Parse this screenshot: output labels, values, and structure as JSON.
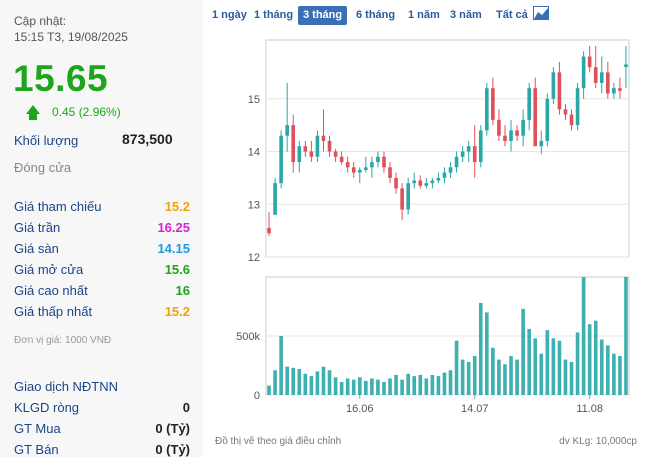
{
  "update": {
    "label": "Cập nhật:",
    "time": "15:15 T3, 19/08/2025"
  },
  "price": "15.65",
  "change": "0.45 (2.96%)",
  "volume": {
    "label": "Khối lượng",
    "value": "873,500"
  },
  "close_label": "Đóng cửa",
  "stats": [
    {
      "label": "Giá tham chiếu",
      "value": "15.2",
      "color": "#f0a30a"
    },
    {
      "label": "Giá trần",
      "value": "16.25",
      "color": "#d426d4"
    },
    {
      "label": "Giá sàn",
      "value": "14.15",
      "color": "#1c9be0"
    },
    {
      "label": "Giá mở cửa",
      "value": "15.6",
      "color": "#1ea51e"
    },
    {
      "label": "Giá cao nhất",
      "value": "16",
      "color": "#1ea51e"
    },
    {
      "label": "Giá thấp nhất",
      "value": "15.2",
      "color": "#f0a30a"
    }
  ],
  "unit_note": "Đơn vị giá: 1000 VNĐ",
  "foreign": {
    "title": "Giao dịch NĐTNN",
    "rows": [
      {
        "label": "KLGD ròng",
        "value": "0"
      },
      {
        "label": "GT Mua",
        "value": "0 (Tỷ)"
      },
      {
        "label": "GT Bán",
        "value": "0 (Tỷ)"
      }
    ]
  },
  "tabs": [
    "1 ngày",
    "1 tháng",
    "3 tháng",
    "6 tháng",
    "1 năm",
    "3 năm",
    "Tất cả"
  ],
  "active_tab": "3 tháng",
  "chart_note": "Đồ thị vẽ theo giá điều chỉnh",
  "volume_note": "dv KLg: 10,000cp",
  "chart_data": {
    "type": "candlestick",
    "price_axis": {
      "ylim": [
        12,
        16
      ],
      "ticks": [
        "12",
        "13",
        "14",
        "15"
      ]
    },
    "volume_axis": {
      "ylim": [
        0,
        1000
      ],
      "ticks": [
        "0",
        "500k"
      ]
    },
    "x_ticks": [
      {
        "label": "16.06",
        "index": 15
      },
      {
        "label": "14.07",
        "index": 34
      },
      {
        "label": "11.08",
        "index": 53
      }
    ],
    "up_color": "#2aa7a7",
    "down_color": "#e0505a",
    "candles": [
      [
        12.55,
        12.85,
        12.4,
        12.45,
        80
      ],
      [
        12.8,
        13.5,
        12.8,
        13.4,
        210
      ],
      [
        13.4,
        14.4,
        13.3,
        14.3,
        500
      ],
      [
        14.3,
        15.3,
        14.0,
        14.5,
        240
      ],
      [
        14.5,
        14.7,
        13.6,
        13.8,
        230
      ],
      [
        13.8,
        14.2,
        13.6,
        14.1,
        220
      ],
      [
        14.1,
        14.2,
        13.9,
        14.0,
        180
      ],
      [
        14.0,
        14.2,
        13.8,
        13.9,
        160
      ],
      [
        13.9,
        14.4,
        13.8,
        14.3,
        200
      ],
      [
        14.3,
        14.8,
        14.0,
        14.2,
        240
      ],
      [
        14.2,
        14.3,
        13.9,
        14.0,
        210
      ],
      [
        14.0,
        14.05,
        13.8,
        13.9,
        150
      ],
      [
        13.9,
        14.0,
        13.75,
        13.8,
        110
      ],
      [
        13.8,
        13.9,
        13.6,
        13.7,
        140
      ],
      [
        13.7,
        13.8,
        13.5,
        13.6,
        130
      ],
      [
        13.6,
        13.7,
        13.4,
        13.65,
        150
      ],
      [
        13.65,
        13.9,
        13.6,
        13.7,
        120
      ],
      [
        13.7,
        13.9,
        13.5,
        13.8,
        140
      ],
      [
        13.8,
        14.0,
        13.7,
        13.9,
        130
      ],
      [
        13.9,
        14.0,
        13.6,
        13.7,
        110
      ],
      [
        13.7,
        13.8,
        13.4,
        13.5,
        140
      ],
      [
        13.5,
        13.6,
        13.2,
        13.3,
        170
      ],
      [
        13.3,
        13.4,
        12.7,
        12.9,
        130
      ],
      [
        12.9,
        13.5,
        12.8,
        13.4,
        180
      ],
      [
        13.4,
        13.6,
        13.3,
        13.45,
        160
      ],
      [
        13.45,
        13.55,
        13.3,
        13.35,
        170
      ],
      [
        13.35,
        13.5,
        13.3,
        13.4,
        140
      ],
      [
        13.4,
        13.5,
        13.3,
        13.45,
        170
      ],
      [
        13.45,
        13.6,
        13.4,
        13.5,
        160
      ],
      [
        13.5,
        13.7,
        13.4,
        13.6,
        190
      ],
      [
        13.6,
        13.8,
        13.5,
        13.7,
        210
      ],
      [
        13.7,
        14.0,
        13.6,
        13.9,
        460
      ],
      [
        13.9,
        14.1,
        13.8,
        14.0,
        300
      ],
      [
        14.0,
        14.2,
        13.8,
        14.1,
        280
      ],
      [
        14.1,
        14.5,
        13.5,
        13.8,
        330
      ],
      [
        13.8,
        14.5,
        13.7,
        14.4,
        780
      ],
      [
        14.4,
        15.3,
        14.3,
        15.2,
        700
      ],
      [
        15.2,
        15.4,
        14.5,
        14.6,
        400
      ],
      [
        14.6,
        14.8,
        14.2,
        14.3,
        300
      ],
      [
        14.3,
        14.5,
        14.1,
        14.2,
        260
      ],
      [
        14.2,
        14.6,
        14.0,
        14.4,
        330
      ],
      [
        14.4,
        14.5,
        14.2,
        14.3,
        300
      ],
      [
        14.3,
        14.8,
        14.1,
        14.6,
        730
      ],
      [
        14.6,
        15.3,
        14.4,
        15.2,
        560
      ],
      [
        15.2,
        15.4,
        14.1,
        14.1,
        480
      ],
      [
        14.1,
        14.4,
        13.95,
        14.2,
        350
      ],
      [
        14.2,
        15.1,
        14.1,
        15.0,
        550
      ],
      [
        15.0,
        15.6,
        14.9,
        15.5,
        480
      ],
      [
        15.5,
        15.7,
        14.7,
        14.8,
        460
      ],
      [
        14.8,
        14.9,
        14.6,
        14.7,
        300
      ],
      [
        14.7,
        14.8,
        14.4,
        14.5,
        280
      ],
      [
        14.5,
        15.3,
        14.4,
        15.2,
        530
      ],
      [
        15.2,
        15.9,
        15.0,
        15.8,
        1000
      ],
      [
        15.8,
        16.0,
        15.5,
        15.6,
        600
      ],
      [
        15.6,
        16.0,
        15.2,
        15.3,
        630
      ],
      [
        15.3,
        15.8,
        15.1,
        15.5,
        470
      ],
      [
        15.5,
        15.7,
        15.0,
        15.1,
        420
      ],
      [
        15.1,
        15.3,
        15.0,
        15.2,
        350
      ],
      [
        15.2,
        15.4,
        15.0,
        15.15,
        330
      ],
      [
        15.6,
        16.0,
        15.2,
        15.65,
        1000
      ]
    ]
  }
}
